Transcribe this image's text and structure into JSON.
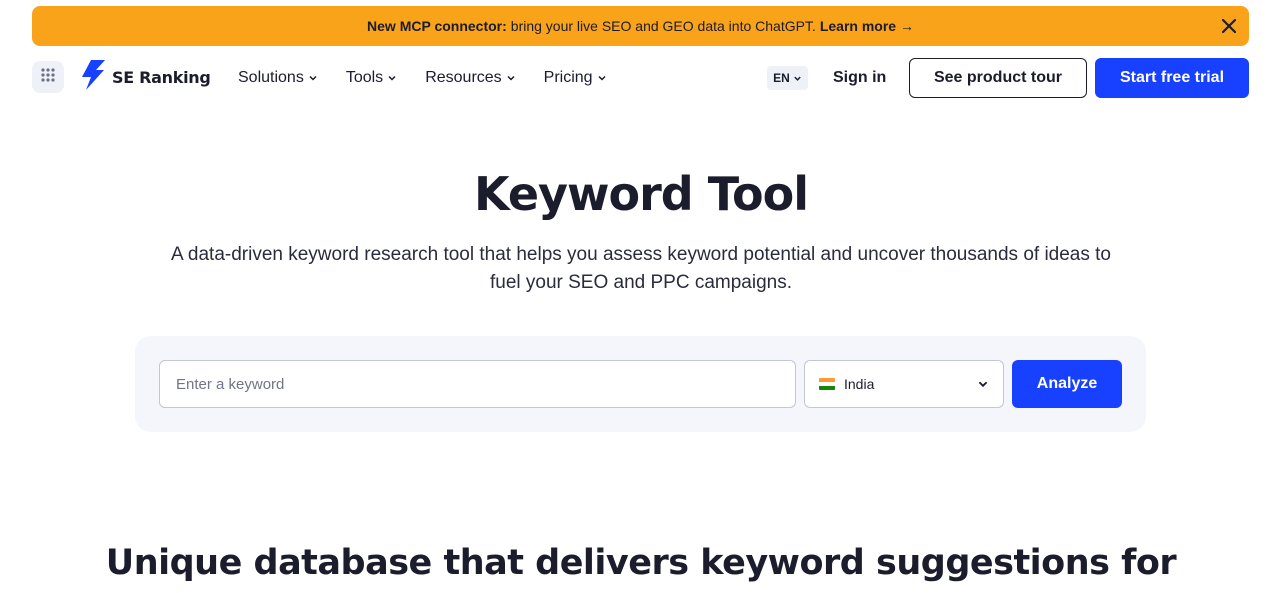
{
  "banner": {
    "bold_text": "New MCP connector:",
    "message": "bring your live SEO and GEO data into ChatGPT.",
    "link_text": "Learn more →",
    "close_icon": "close-icon",
    "color": "#f9a31a"
  },
  "header": {
    "apps_icon": "grid-dots-icon",
    "logo_text": "SE Ranking",
    "nav": [
      {
        "label": "Solutions"
      },
      {
        "label": "Tools"
      },
      {
        "label": "Resources"
      },
      {
        "label": "Pricing"
      }
    ],
    "language": "EN",
    "sign_in": "Sign in",
    "product_tour": "See product tour",
    "free_trial": "Start free trial",
    "accent_color": "#1741ff"
  },
  "hero": {
    "title": "Keyword Tool",
    "subtitle": "A data-driven keyword research tool that helps you assess keyword potential and uncover thousands of ideas to fuel your SEO and PPC campaigns."
  },
  "search": {
    "keyword_placeholder": "Enter a keyword",
    "keyword_value": "",
    "country": "India",
    "country_flag_icon": "india-flag-icon",
    "analyze_label": "Analyze"
  },
  "section": {
    "title": "Unique database that delivers keyword suggestions for"
  }
}
